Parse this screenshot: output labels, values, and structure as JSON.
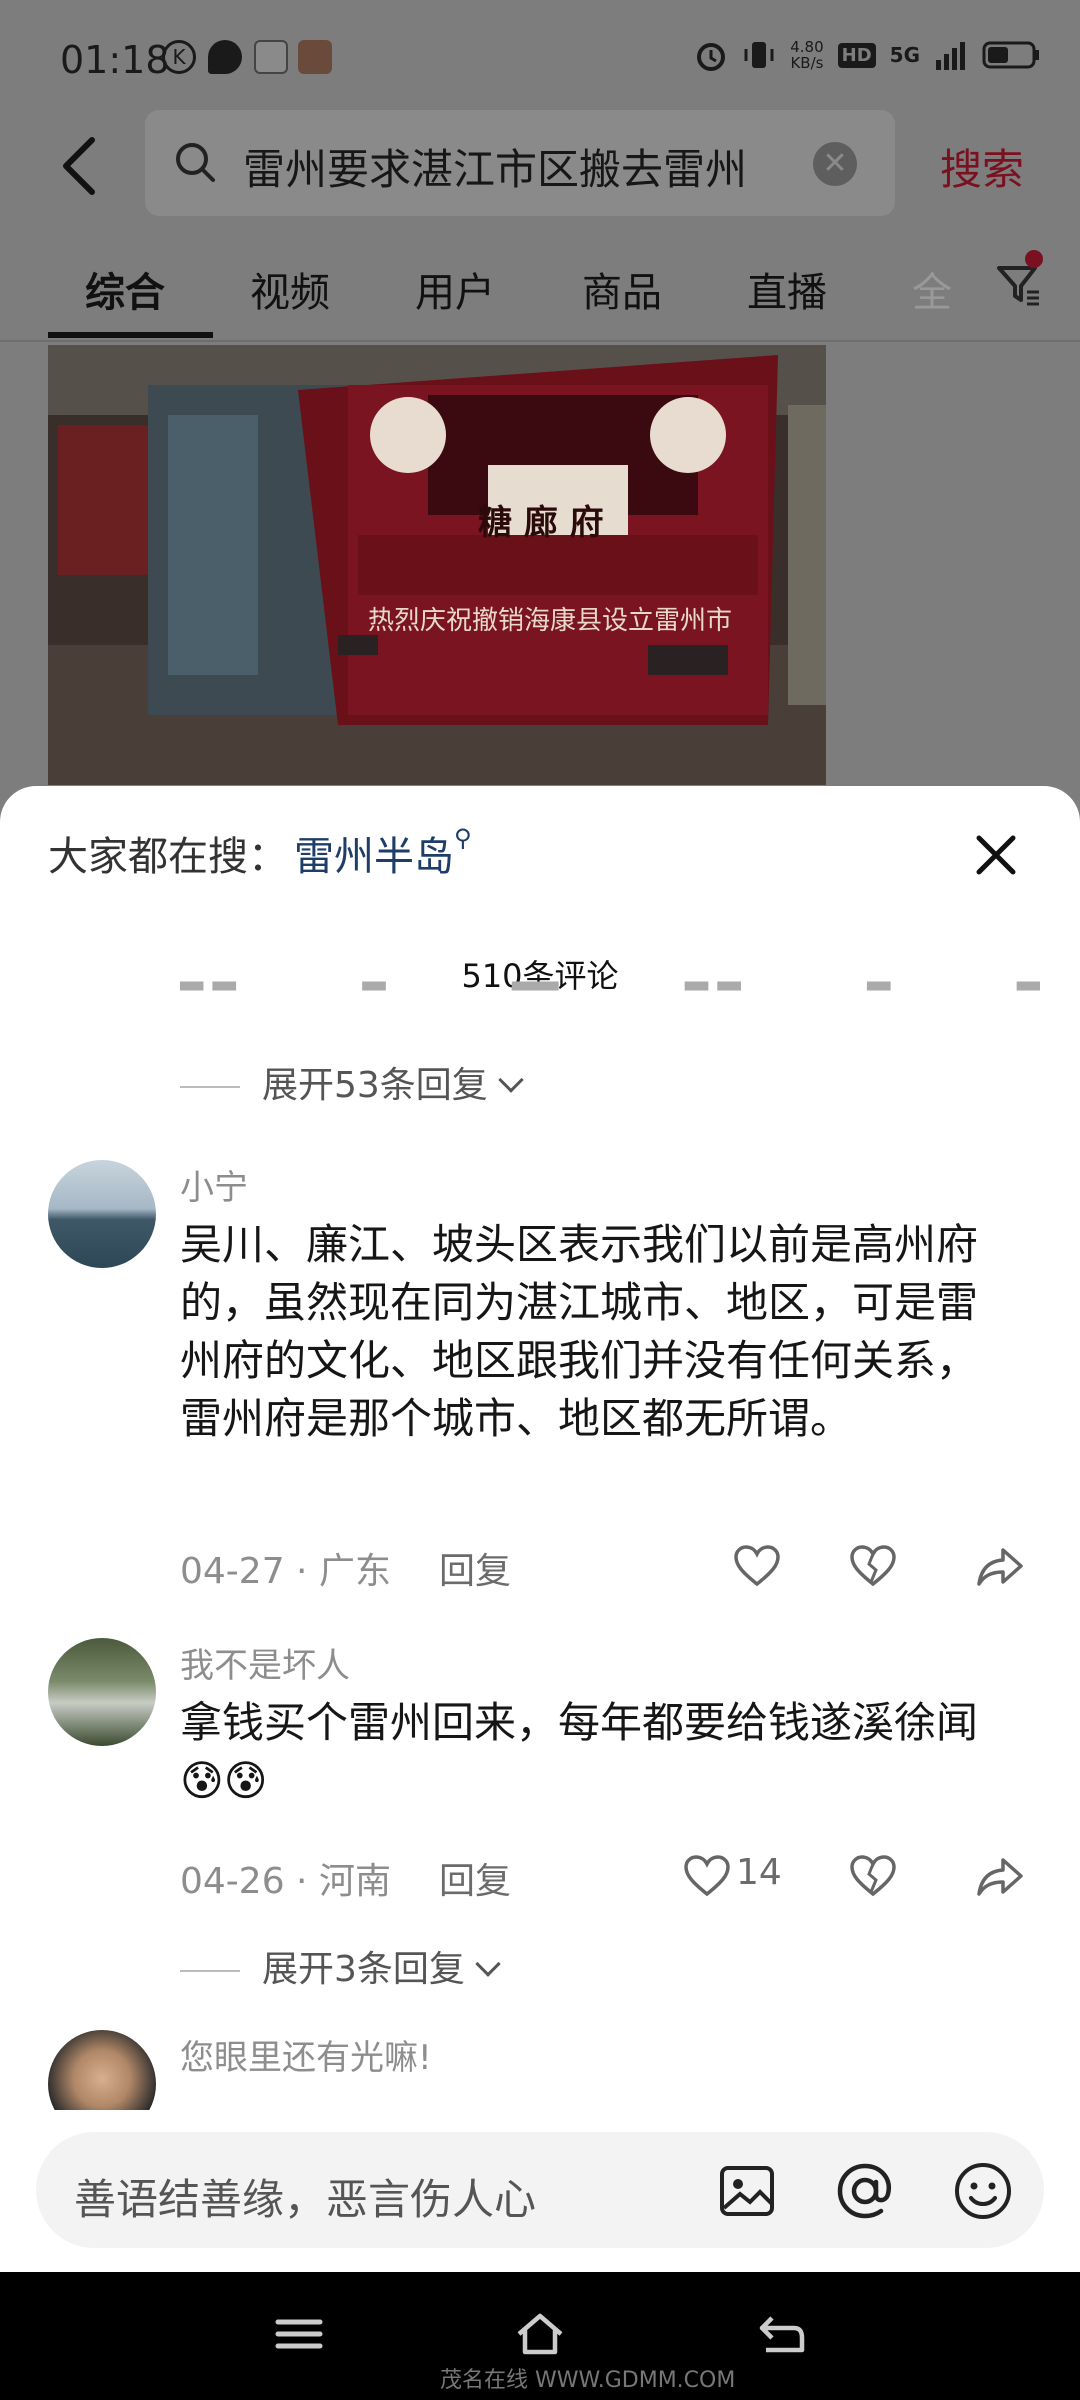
{
  "status_bar": {
    "time": "01:18",
    "net_speed": "4.80\nKB/s",
    "network": "5G",
    "hd": "HD"
  },
  "search": {
    "query": "雷州要求湛江市区搬去雷州",
    "button": "搜索"
  },
  "tabs": [
    "综合",
    "视频",
    "用户",
    "商品",
    "直播",
    "全"
  ],
  "thumbnail": {
    "sign_top": "糖 廊 府",
    "banner": "热烈庆祝撤销海康县设立雷州市"
  },
  "comments_sheet": {
    "hot_search_label": "大家都在搜：",
    "hot_search_keyword": "雷州半岛",
    "count_label": "510条评论",
    "expand_first": "展开53条回复",
    "comments": [
      {
        "user": "小宁",
        "text": "吴川、廉江、坡头区表示我们以前是高州府的，虽然现在同为湛江城市、地区，可是雷州府的文化、地区跟我们并没有任何关系，雷州府是那个城市、地区都无所谓。",
        "date": "04-27",
        "location": "广东",
        "reply": "回复",
        "likes": ""
      },
      {
        "user": "我不是坏人",
        "text": "拿钱买个雷州回来，每年都要给钱遂溪徐闻😰😰",
        "date": "04-26",
        "location": "河南",
        "reply": "回复",
        "likes": "14",
        "expand": "展开3条回复"
      },
      {
        "user": "您眼里还有光嘛!"
      }
    ]
  },
  "input": {
    "placeholder": "善语结善缘，恶言伤人心"
  },
  "watermark": "茂名在线 WWW.GDMM.COM"
}
